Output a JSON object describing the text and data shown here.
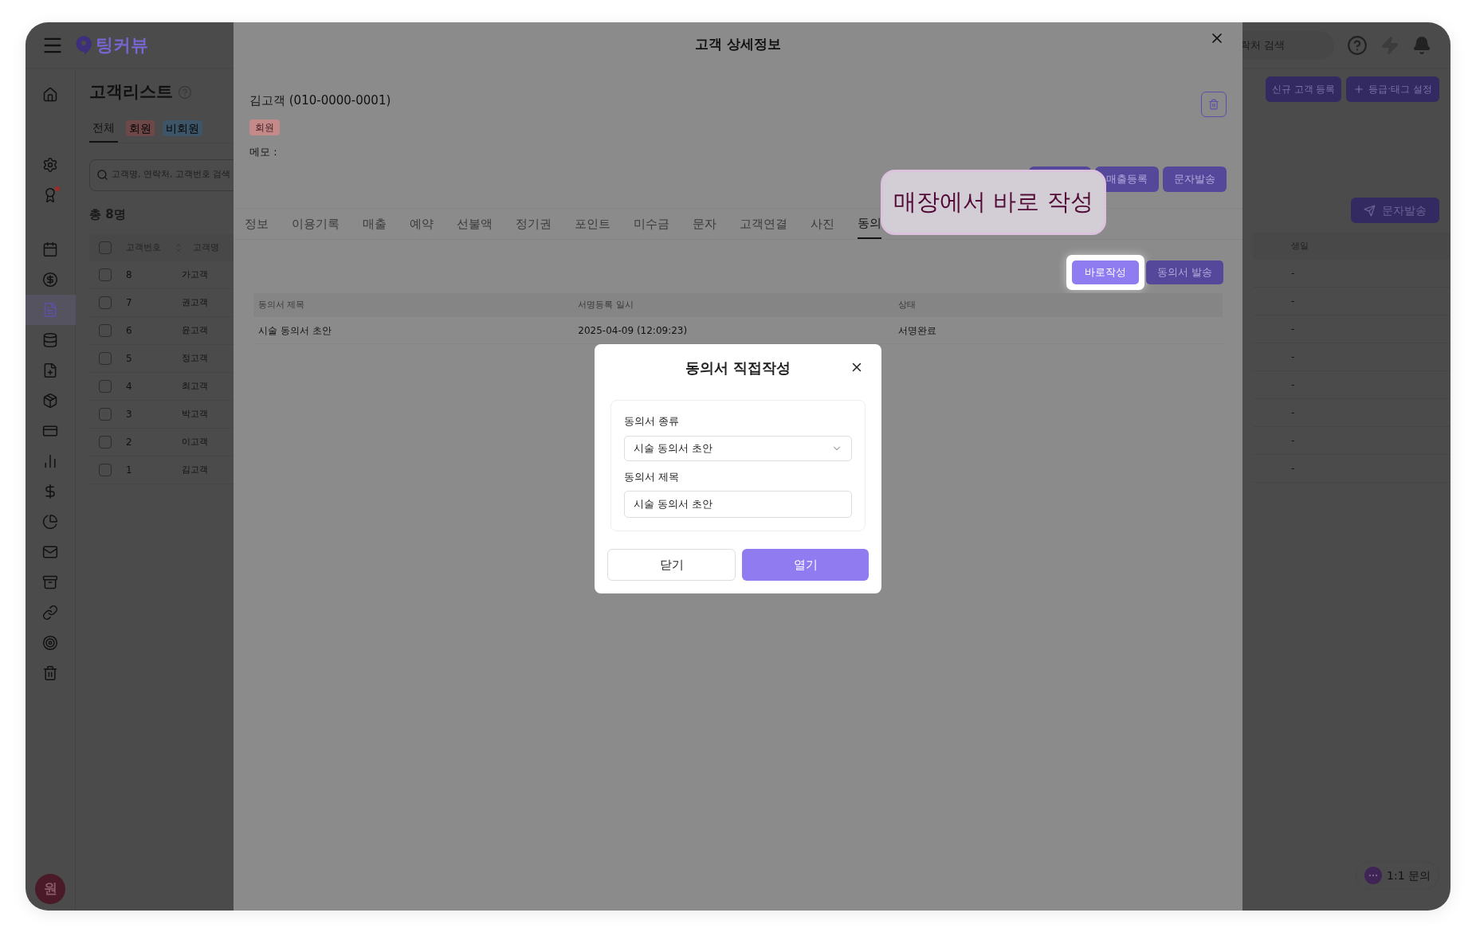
{
  "app": {
    "logo_text": "팅커뷰",
    "header_search": {
      "placeholder": "락처 검색"
    },
    "avatar": "원",
    "chat_button": "1:1 문의"
  },
  "sidebar": {
    "items": [
      {
        "selected": false,
        "notification": false
      },
      {
        "selected": false,
        "notification": false
      },
      {
        "selected": false,
        "notification": true
      },
      {
        "selected": false,
        "notification": false
      },
      {
        "selected": false,
        "notification": false
      },
      {
        "selected": true,
        "notification": false
      },
      {
        "selected": false,
        "notification": false
      },
      {
        "selected": false,
        "notification": false
      },
      {
        "selected": false,
        "notification": false
      },
      {
        "selected": false,
        "notification": false
      },
      {
        "selected": false,
        "notification": false
      },
      {
        "selected": false,
        "notification": false
      },
      {
        "selected": false,
        "notification": false
      },
      {
        "selected": false,
        "notification": false
      },
      {
        "selected": false,
        "notification": false
      },
      {
        "selected": false,
        "notification": false
      },
      {
        "selected": false,
        "notification": false
      },
      {
        "selected": false,
        "notification": false
      }
    ]
  },
  "customer_list": {
    "title": "고객리스트",
    "filters": [
      {
        "label": "전체",
        "selected": true
      },
      {
        "label": "회원",
        "selected": false,
        "color": "#6e4848"
      },
      {
        "label": "비회원",
        "selected": false,
        "color": "#3d5566"
      }
    ],
    "search": {
      "placeholder": "고객명, 연락처, 고객번호 검색"
    },
    "count": "총 8명",
    "all_checked": false,
    "columns": [
      "고객번호",
      "고객명"
    ],
    "rows": [
      {
        "number": "8",
        "name": "가고객",
        "checked": false
      },
      {
        "number": "7",
        "name": "권고객",
        "checked": false
      },
      {
        "number": "6",
        "name": "윤고객",
        "checked": false
      },
      {
        "number": "5",
        "name": "정고객",
        "checked": false
      },
      {
        "number": "4",
        "name": "최고객",
        "checked": false
      },
      {
        "number": "3",
        "name": "박고객",
        "checked": false
      },
      {
        "number": "2",
        "name": "이고객",
        "checked": false
      },
      {
        "number": "1",
        "name": "김고객",
        "checked": false
      }
    ],
    "right_buttons": [
      "신규 고객 등록",
      "등급·태그 설정"
    ],
    "sms_button": "문자발송",
    "birthday_column": "생일",
    "birthdays": [
      "-",
      "-",
      "-",
      "-",
      "-",
      "-",
      "-",
      "-"
    ]
  },
  "drawer": {
    "title": "고객 상세정보",
    "customer": "김고객 (010-0000-0001)",
    "badge": "회원",
    "memo": "메모 :",
    "actions": [
      "매출등록",
      "문자발송"
    ],
    "tabs": [
      {
        "label": "정보",
        "selected": false
      },
      {
        "label": "이용기록",
        "selected": false
      },
      {
        "label": "매출",
        "selected": false
      },
      {
        "label": "예약",
        "selected": false
      },
      {
        "label": "선불액",
        "selected": false
      },
      {
        "label": "정기권",
        "selected": false
      },
      {
        "label": "포인트",
        "selected": false
      },
      {
        "label": "미수금",
        "selected": false
      },
      {
        "label": "문자",
        "selected": false
      },
      {
        "label": "고객연결",
        "selected": false
      },
      {
        "label": "사진",
        "selected": false
      },
      {
        "label": "동의",
        "selected": true
      }
    ],
    "consent_buttons": [
      {
        "label": "바로작성",
        "highlighted": true
      },
      {
        "label": "동의서 발송",
        "highlighted": false
      }
    ],
    "table": {
      "columns": [
        "동의서 제목",
        "서명등록 일시",
        "상태"
      ],
      "rows": [
        [
          "시술 동의서 초안",
          "2025-04-09 (12:09:23)",
          "서명완료"
        ]
      ]
    },
    "callout": "매장에서 바로 작성"
  },
  "dialog": {
    "title": "동의서 직접작성",
    "fields": [
      {
        "kind": "select",
        "label": "동의서 종류",
        "value": "시술 동의서 초안"
      },
      {
        "kind": "text",
        "label": "동의서 제목",
        "value": "시술 동의서 초안"
      }
    ],
    "buttons": [
      {
        "kind": "secondary",
        "label": "닫기"
      },
      {
        "kind": "primary",
        "label": "열기"
      }
    ]
  }
}
